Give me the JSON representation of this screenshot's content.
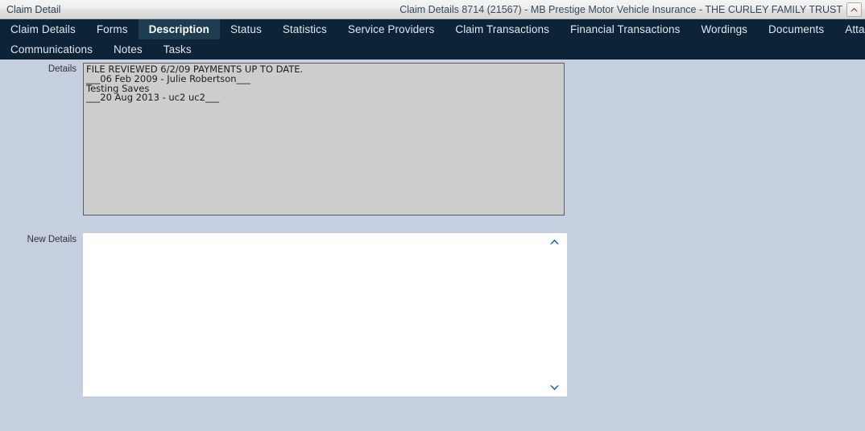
{
  "window": {
    "title": "Claim Detail",
    "context_title": "Claim Details 8714 (21567) - MB Prestige Motor Vehicle Insurance - THE CURLEY FAMILY TRUST",
    "collapse_icon": "chevron-up-icon",
    "collapse_icon_color": "#8a5a3a"
  },
  "tabs": {
    "active": "Description",
    "row1": [
      {
        "label": "Claim Details",
        "active": false
      },
      {
        "label": "Forms",
        "active": false
      },
      {
        "label": "Description",
        "active": true
      },
      {
        "label": "Status",
        "active": false
      },
      {
        "label": "Statistics",
        "active": false
      },
      {
        "label": "Service Providers",
        "active": false
      },
      {
        "label": "Claim Transactions",
        "active": false
      },
      {
        "label": "Financial Transactions",
        "active": false
      },
      {
        "label": "Wordings",
        "active": false
      },
      {
        "label": "Documents",
        "active": false
      },
      {
        "label": "Attachments",
        "active": false
      }
    ],
    "row2": [
      {
        "label": "Communications",
        "active": false
      },
      {
        "label": "Notes",
        "active": false
      },
      {
        "label": "Tasks",
        "active": false
      }
    ]
  },
  "form": {
    "details": {
      "label": "Details",
      "value": "FILE REVIEWED 6/2/09 PAYMENTS UP TO DATE.\n___06 Feb 2009 - Julie Robertson___\nTesting Saves\n___20 Aug 2013 - uc2 uc2___",
      "readonly": true,
      "scrollbar": {
        "up_icon": "chevron-up-icon",
        "down_icon": "chevron-down-icon",
        "arrow_color": "#1f5fa8"
      }
    },
    "new_details": {
      "label": "New Details",
      "value": "",
      "placeholder": "",
      "readonly": false,
      "scrollbar": {
        "up_icon": "chevron-up-icon",
        "down_icon": "chevron-down-icon",
        "arrow_color": "#1f5fa8"
      }
    }
  },
  "colors": {
    "page_background": "#c5cfdf",
    "tabbar_background": "#0d2438",
    "active_tab_background": "#1e3c52",
    "readonly_field_background": "#cdcdcd",
    "accent": "#1f5fa8"
  }
}
